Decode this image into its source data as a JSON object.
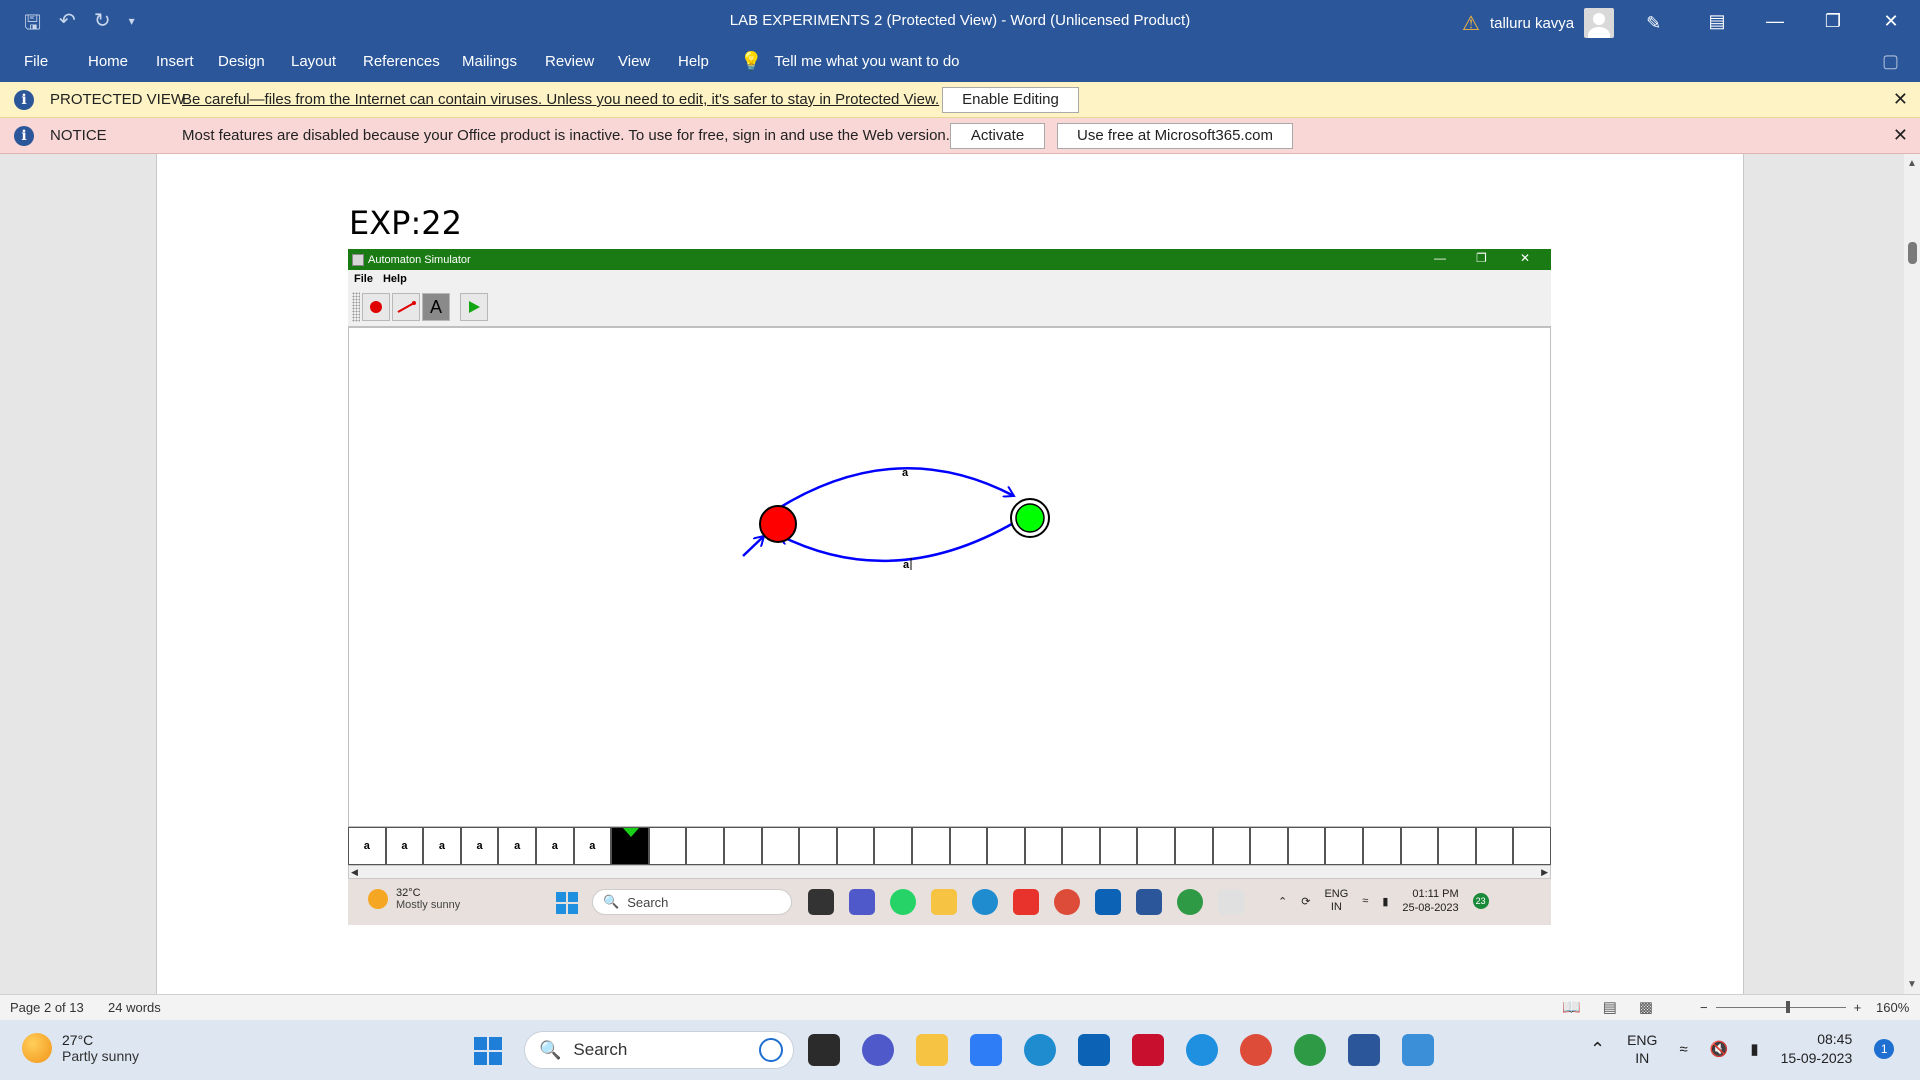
{
  "titlebar": {
    "title": "LAB EXPERIMENTS 2 (Protected View)  -  Word (Unlicensed Product)",
    "user_name": "talluru kavya"
  },
  "menubar": {
    "tabs": [
      "File",
      "Home",
      "Insert",
      "Design",
      "Layout",
      "References",
      "Mailings",
      "Review",
      "View",
      "Help"
    ],
    "tell_me": "Tell me what you want to do"
  },
  "protected_bar": {
    "label": "PROTECTED VIEW",
    "message": "Be careful—files from the Internet can contain viruses. Unless you need to edit, it's safer to stay in Protected View.",
    "button": "Enable Editing"
  },
  "notice_bar": {
    "label": "NOTICE",
    "message": "Most features are disabled because your Office product is inactive. To use for free, sign in and use the Web version.",
    "activate_button": "Activate",
    "web_button": "Use free at Microsoft365.com"
  },
  "document": {
    "heading": "EXP:22"
  },
  "simulator": {
    "title": "Automaton Simulator",
    "menu": [
      "File",
      "Help"
    ],
    "tool_text": "A",
    "edge_labels": {
      "top": "a",
      "bottom": "a"
    },
    "tape": [
      "a",
      "a",
      "a",
      "a",
      "a",
      "a",
      "a"
    ],
    "tape_cells_total": 32,
    "head_index": 7,
    "colors": {
      "start_state": "#ff0000",
      "final_state": "#00ff00",
      "edges": "#0000ff",
      "titlebar": "#1a7a14"
    }
  },
  "inner_taskbar": {
    "temp": "32°C",
    "weather": "Mostly sunny",
    "search": "Search",
    "lang": "ENG",
    "region": "IN",
    "time": "01:11 PM",
    "date": "25-08-2023",
    "badge": "23"
  },
  "statusbar": {
    "page": "Page 2 of 13",
    "words": "24 words",
    "zoom": "160%"
  },
  "taskbar": {
    "temp": "27°C",
    "weather": "Partly sunny",
    "search": "Search",
    "lang": "ENG",
    "region": "IN",
    "time": "08:45",
    "date": "15-09-2023",
    "notifications": "1"
  }
}
